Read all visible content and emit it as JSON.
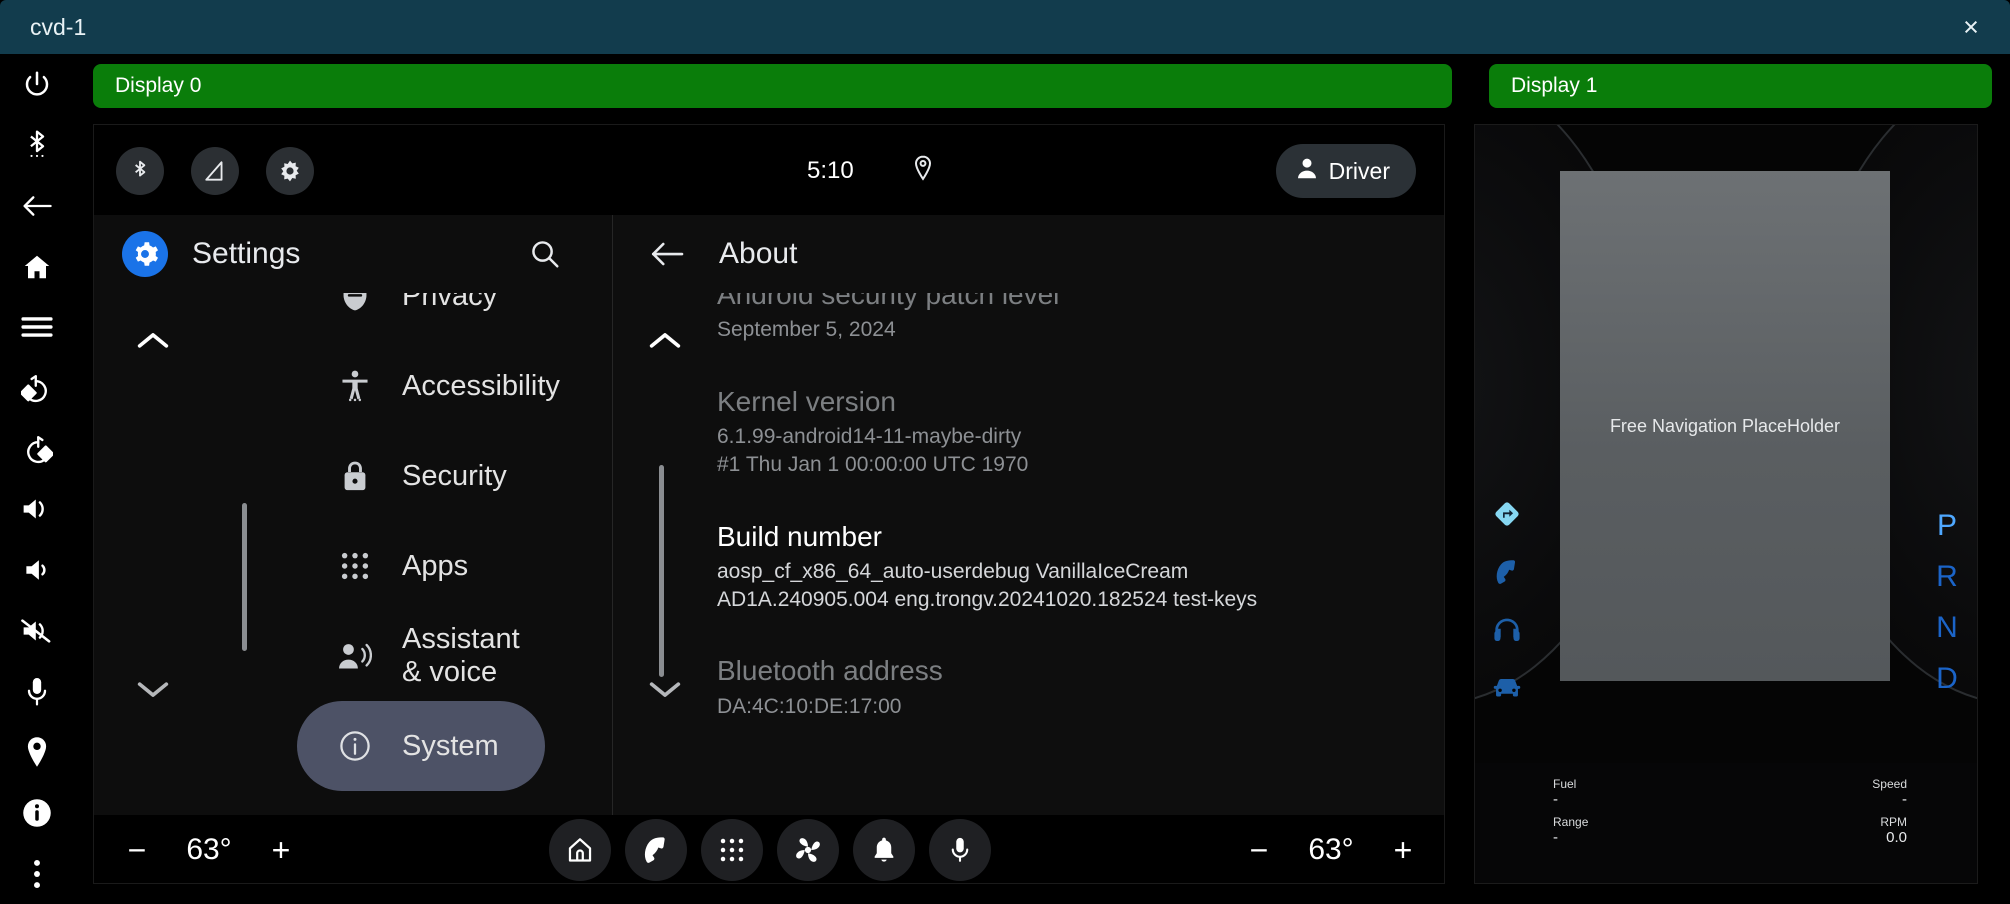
{
  "window": {
    "title": "cvd-1",
    "close_label": "×"
  },
  "emulator_toolbar": {
    "items": [
      {
        "icon": "power-icon",
        "name": "power-button"
      },
      {
        "icon": "bluetooth-icon",
        "name": "bluetooth-button"
      },
      {
        "icon": "back-arrow-icon",
        "name": "back-button"
      },
      {
        "icon": "home-icon",
        "name": "home-button"
      },
      {
        "icon": "menu-icon",
        "name": "overview-button"
      },
      {
        "icon": "rotate-left-icon",
        "name": "rotate-left-button"
      },
      {
        "icon": "rotate-right-icon",
        "name": "rotate-right-button"
      },
      {
        "icon": "volume-up-icon",
        "name": "volume-up-button"
      },
      {
        "icon": "volume-down-icon",
        "name": "volume-down-button"
      },
      {
        "icon": "volume-mute-icon",
        "name": "volume-mute-button"
      },
      {
        "icon": "microphone-icon",
        "name": "microphone-button"
      },
      {
        "icon": "location-pin-icon",
        "name": "location-button"
      },
      {
        "icon": "info-circle-icon",
        "name": "info-button"
      },
      {
        "icon": "more-vertical-icon",
        "name": "more-button"
      }
    ]
  },
  "display0": {
    "label": "Display 0",
    "status_bar": {
      "bluetooth_icon": "bluetooth-icon",
      "signal_icon": "signal-triangle-icon",
      "brightness_icon": "brightness-icon",
      "time": "5:10",
      "location_icon": "location-pin-icon",
      "user_label": "Driver",
      "user_icon": "person-icon"
    },
    "settings_pane": {
      "title": "Settings",
      "app_icon": "gear-icon",
      "search_icon": "search-icon",
      "scroll_up_icon": "chevron-up-icon",
      "scroll_down_icon": "chevron-down-icon",
      "items": [
        {
          "label": "Privacy",
          "icon": "privacy-shield-icon",
          "selected": false
        },
        {
          "label": "Accessibility",
          "icon": "accessibility-icon",
          "selected": false
        },
        {
          "label": "Security",
          "icon": "lock-icon",
          "selected": false
        },
        {
          "label": "Apps",
          "icon": "apps-grid-icon",
          "selected": false
        },
        {
          "label": "Assistant & voice",
          "icon": "assistant-voice-icon",
          "selected": false
        },
        {
          "label": "System",
          "icon": "info-circle-icon",
          "selected": true
        }
      ]
    },
    "about_pane": {
      "title": "About",
      "back_icon": "back-arrow-icon",
      "scroll_up_icon": "chevron-up-icon",
      "scroll_down_icon": "chevron-down-icon",
      "rows": [
        {
          "key": "Android security patch level",
          "value": "September 5, 2024",
          "highlight": false
        },
        {
          "key": "Kernel version",
          "value": "6.1.99-android14-11-maybe-dirty\n#1 Thu Jan  1 00:00:00 UTC 1970",
          "highlight": false
        },
        {
          "key": "Build number",
          "value": "aosp_cf_x86_64_auto-userdebug VanillaIceCream\nAD1A.240905.004 eng.trongv.20241020.182524 test-keys",
          "highlight": true
        },
        {
          "key": "Bluetooth address",
          "value": "DA:4C:10:DE:17:00",
          "highlight": false
        }
      ]
    },
    "bottom_bar": {
      "left_temp": {
        "minus": "−",
        "value": "63°",
        "plus": "+"
      },
      "right_temp": {
        "minus": "−",
        "value": "63°",
        "plus": "+"
      },
      "chips": [
        {
          "icon": "home-icon",
          "name": "nav-home-button"
        },
        {
          "icon": "phone-icon",
          "name": "nav-dialer-button"
        },
        {
          "icon": "apps-grid-icon",
          "name": "nav-apps-button"
        },
        {
          "icon": "fan-icon",
          "name": "nav-climate-button"
        },
        {
          "icon": "bell-icon",
          "name": "nav-notifications-button"
        },
        {
          "icon": "microphone-icon",
          "name": "nav-assistant-button"
        }
      ]
    }
  },
  "display1": {
    "label": "Display 1",
    "nav_placeholder": "Free Navigation PlaceHolder",
    "side_icons": [
      {
        "icon": "navigation-arrow-icon",
        "name": "cluster-navigation-icon"
      },
      {
        "icon": "phone-icon",
        "name": "cluster-phone-icon"
      },
      {
        "icon": "headphones-icon",
        "name": "cluster-media-icon"
      },
      {
        "icon": "car-icon",
        "name": "cluster-car-icon"
      }
    ],
    "gears": [
      {
        "letter": "P",
        "active": true
      },
      {
        "letter": "R",
        "active": false
      },
      {
        "letter": "N",
        "active": false
      },
      {
        "letter": "D",
        "active": false
      }
    ],
    "info": {
      "fuel_label": "Fuel",
      "fuel_value": "-",
      "range_label": "Range",
      "range_value": "-",
      "speed_label": "Speed",
      "speed_value": "-",
      "rpm_label": "RPM",
      "rpm_value": "0.0"
    }
  },
  "colors": {
    "titlebar": "#123c4d",
    "display_label_green": "#0a7d0a",
    "accent_blue": "#1a73e8",
    "selected_item": "#4d5266",
    "gear_active": "#4fa8ff"
  }
}
